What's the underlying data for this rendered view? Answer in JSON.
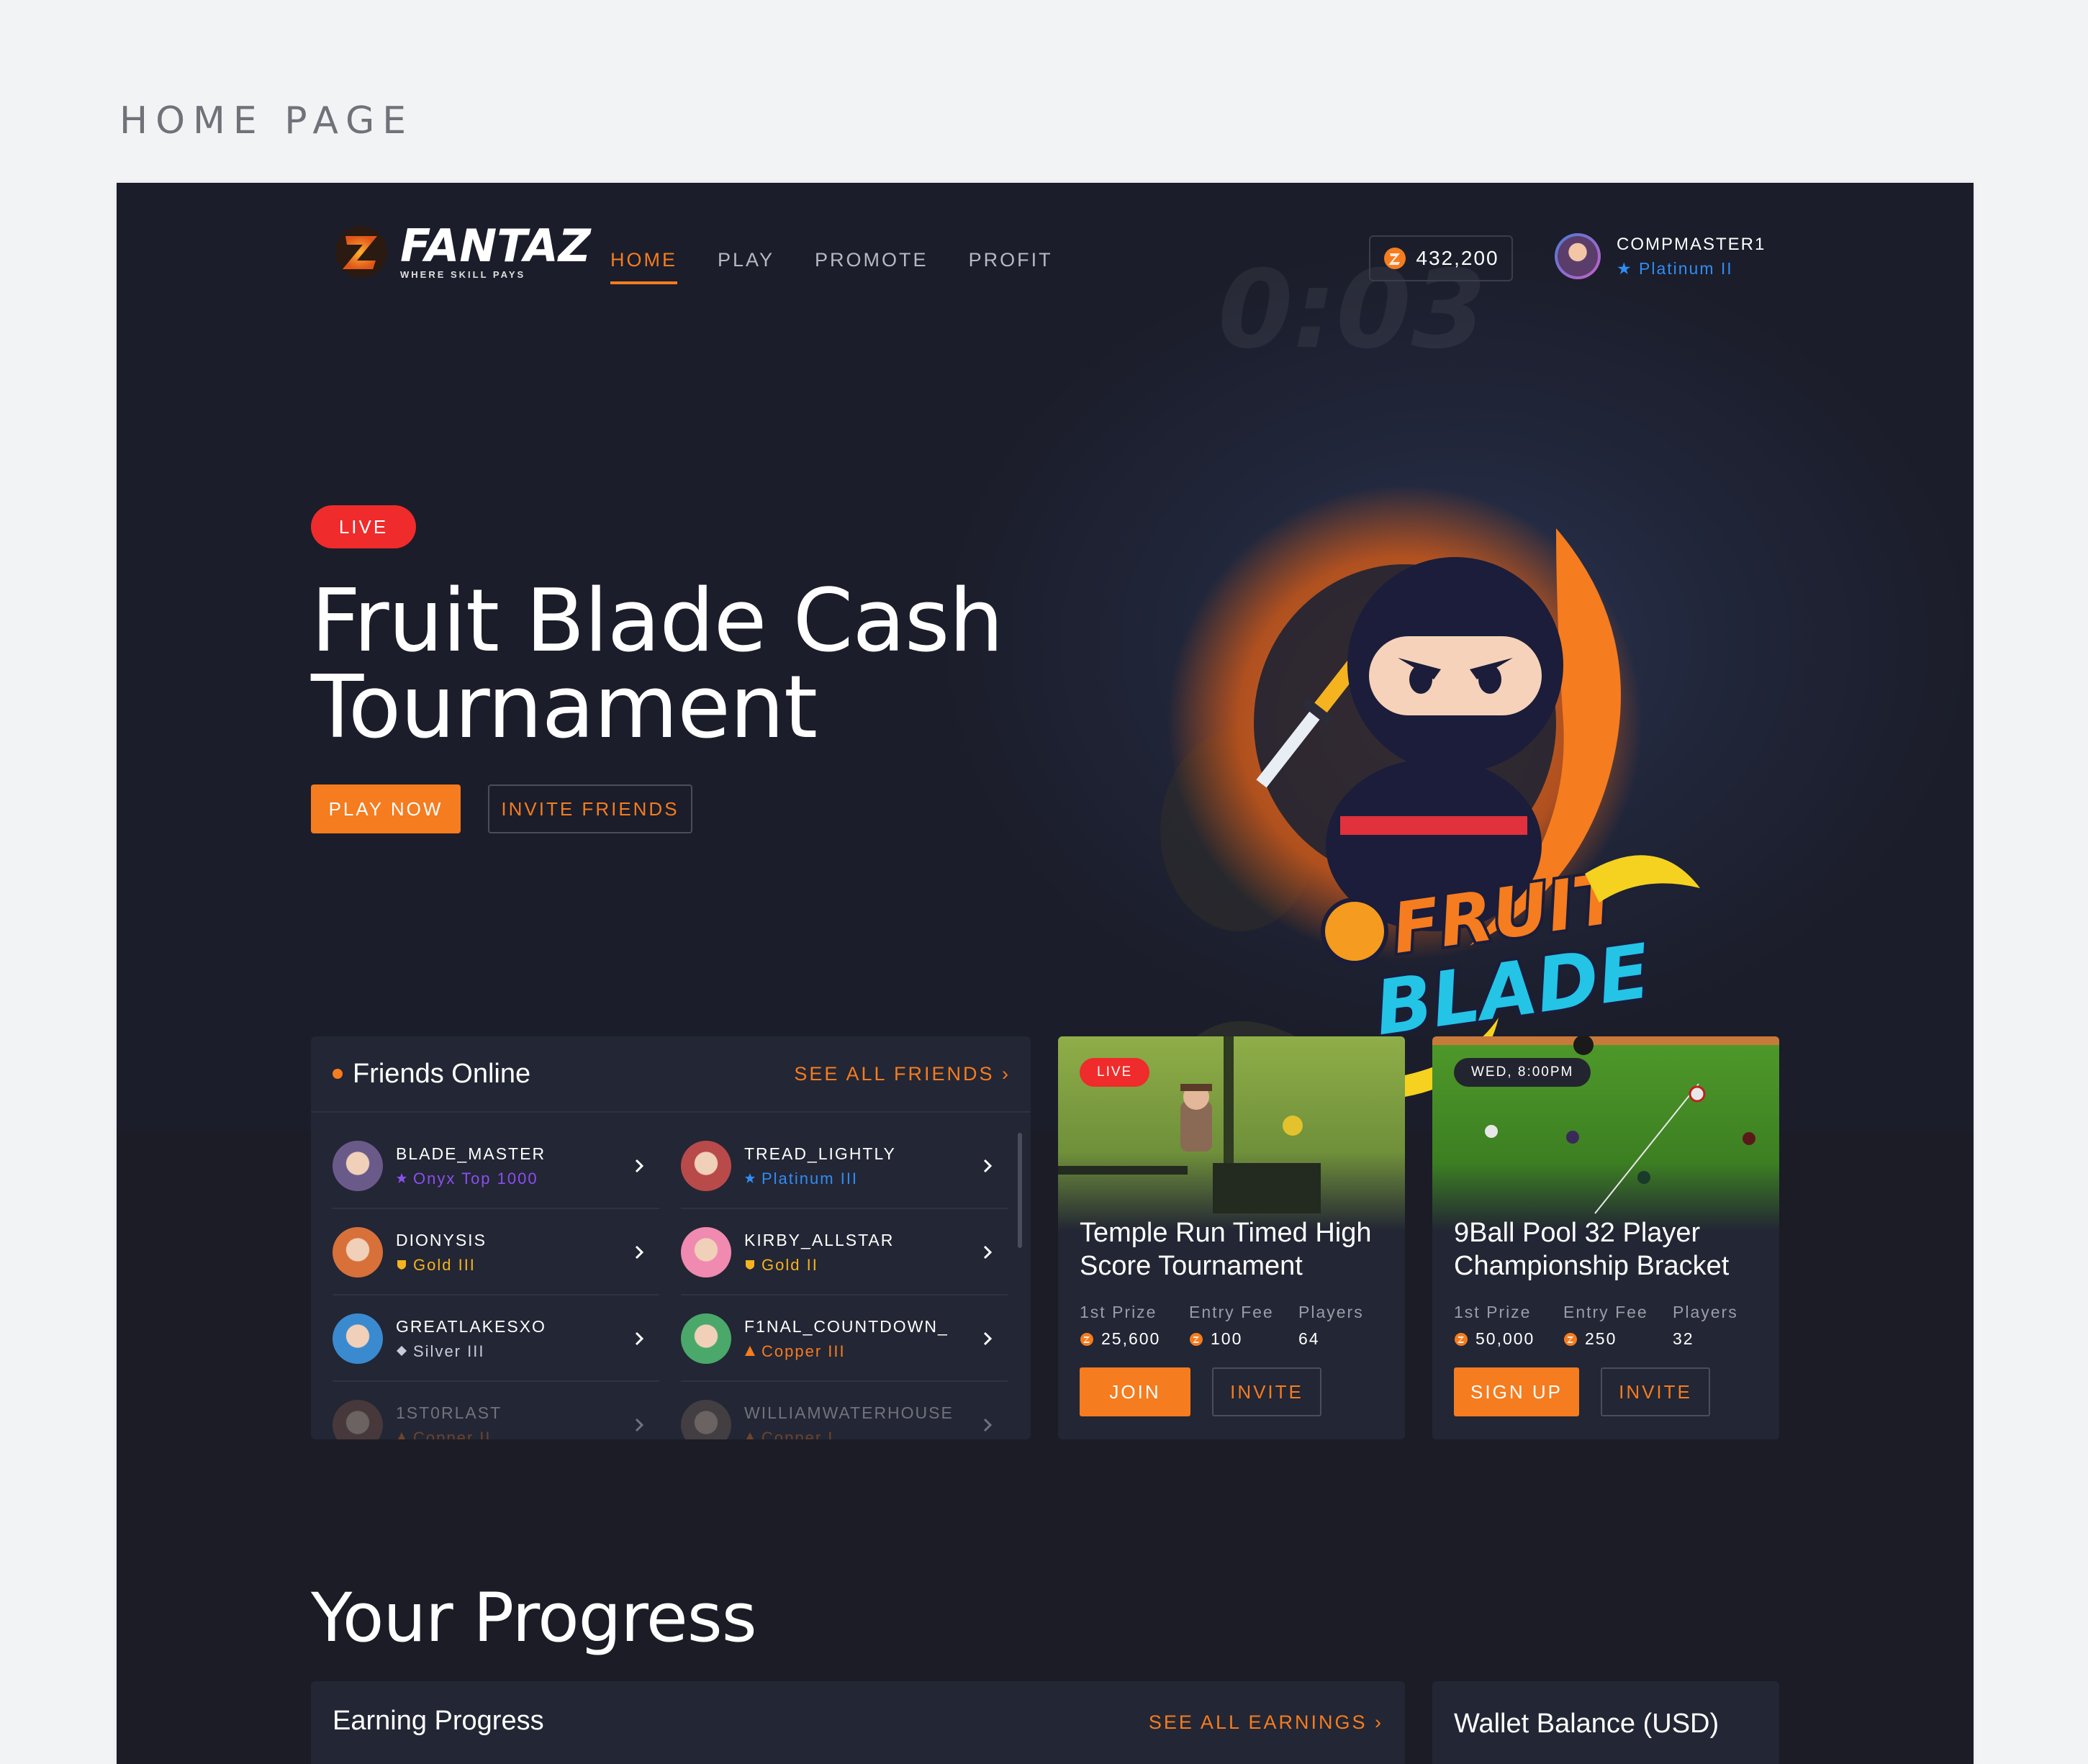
{
  "page_heading": "HOME PAGE",
  "brand": {
    "name": "FANTAZ",
    "tagline": "WHERE SKILL PAYS",
    "accent": "#f57c1f"
  },
  "nav": {
    "items": [
      "HOME",
      "PLAY",
      "PROMOTE",
      "PROFIT"
    ],
    "active": "HOME"
  },
  "wallet": {
    "coins": "432,200"
  },
  "user": {
    "name": "COMPMASTER1",
    "rank": "Platinum II",
    "rank_color": "#2f8df5"
  },
  "hero": {
    "badge": "LIVE",
    "title": "Fruit Blade Cash Tournament",
    "play_label": "PLAY NOW",
    "invite_label": "INVITE FRIENDS",
    "timer_watermark": "0:03",
    "art_text_1": "FRUIT",
    "art_text_2": "BLADE"
  },
  "friends": {
    "title": "Friends Online",
    "see_all": "SEE ALL FRIENDS",
    "list": [
      {
        "name": "BLADE_MASTER",
        "rank": "Onyx Top 1000",
        "rank_color": "#8a4ff0",
        "rank_icon": "star-icon"
      },
      {
        "name": "TREAD_LIGHTLY",
        "rank": "Platinum III",
        "rank_color": "#2f8df5",
        "rank_icon": "star-icon"
      },
      {
        "name": "DIONYSIS",
        "rank": "Gold III",
        "rank_color": "#f5b31f",
        "rank_icon": "shield-icon"
      },
      {
        "name": "KIRBY_ALLSTAR",
        "rank": "Gold II",
        "rank_color": "#f5b31f",
        "rank_icon": "shield-icon"
      },
      {
        "name": "GREATLAKESXO",
        "rank": "Silver III",
        "rank_color": "#c9ccd6",
        "rank_icon": "diamond-icon"
      },
      {
        "name": "F1NAL_COUNTDOWN_",
        "rank": "Copper III",
        "rank_color": "#f57c1f",
        "rank_icon": "triangle-icon"
      },
      {
        "name": "1ST0RLAST",
        "rank": "Copper II",
        "rank_color": "#f57c1f",
        "rank_icon": "triangle-icon"
      },
      {
        "name": "WILLIAMWATERHOUSE",
        "rank": "Copper I",
        "rank_color": "#f57c1f",
        "rank_icon": "triangle-icon"
      }
    ]
  },
  "tournaments": [
    {
      "badge": "LIVE",
      "title": "Temple Run Timed High Score Tournament",
      "stats": [
        {
          "label": "1st Prize",
          "value": "25,600",
          "coin": true
        },
        {
          "label": "Entry Fee",
          "value": "100",
          "coin": true
        },
        {
          "label": "Players",
          "value": "64",
          "coin": false
        }
      ],
      "primary_label": "JOIN",
      "secondary_label": "INVITE"
    },
    {
      "badge": "WED, 8:00PM",
      "title": "9Ball Pool 32 Player Championship Bracket",
      "stats": [
        {
          "label": "1st Prize",
          "value": "50,000",
          "coin": true
        },
        {
          "label": "Entry Fee",
          "value": "250",
          "coin": true
        },
        {
          "label": "Players",
          "value": "32",
          "coin": false
        }
      ],
      "primary_label": "SIGN UP",
      "secondary_label": "INVITE"
    }
  ],
  "progress": {
    "title": "Your Progress",
    "earning_title": "Earning Progress",
    "see_all_earnings": "SEE ALL EARNINGS",
    "wallet_title": "Wallet Balance (USD)"
  }
}
